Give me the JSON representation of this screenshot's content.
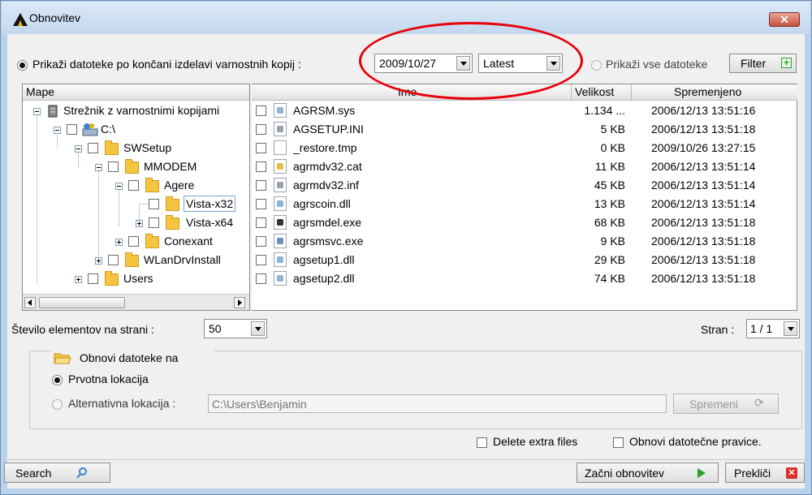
{
  "window": {
    "title": "Obnovitev",
    "close_label": "✕"
  },
  "options": {
    "show_after_backup_label": "Prikaži datoteke po končani izdelavi varnostnih kopij :",
    "date_value": "2009/10/27",
    "version_value": "Latest",
    "show_all_label": "Prikaži vse datoteke",
    "filter_label": "Filter"
  },
  "tree": {
    "header": "Mape",
    "items": [
      {
        "label": "Strežnik z varnostnimi kopijami"
      },
      {
        "label": "C:\\"
      },
      {
        "label": "SWSetup"
      },
      {
        "label": "MMODEM"
      },
      {
        "label": "Agere"
      },
      {
        "label": "Vista-x32"
      },
      {
        "label": "Vista-x64"
      },
      {
        "label": "Conexant"
      },
      {
        "label": "WLanDrvInstall"
      },
      {
        "label": "Users"
      }
    ]
  },
  "files": {
    "columns": {
      "name": "Ime",
      "size": "Velikost",
      "modified": "Spremenjeno"
    },
    "rows": [
      {
        "name": "AGRSM.sys",
        "size": "1.134 ...",
        "modified": "2006/12/13 13:51:16",
        "icon": "sys-file-icon"
      },
      {
        "name": "AGSETUP.INI",
        "size": "5 KB",
        "modified": "2006/12/13 13:51:18",
        "icon": "ini-file-icon"
      },
      {
        "name": "_restore.tmp",
        "size": "0 KB",
        "modified": "2009/10/26 13:27:15",
        "icon": "blank-file-icon"
      },
      {
        "name": "agrmdv32.cat",
        "size": "11 KB",
        "modified": "2006/12/13 13:51:14",
        "icon": "cat-file-icon"
      },
      {
        "name": "agrmdv32.inf",
        "size": "45 KB",
        "modified": "2006/12/13 13:51:14",
        "icon": "inf-file-icon"
      },
      {
        "name": "agrscoin.dll",
        "size": "13 KB",
        "modified": "2006/12/13 13:51:14",
        "icon": "dll-file-icon"
      },
      {
        "name": "agrsmdel.exe",
        "size": "68 KB",
        "modified": "2006/12/13 13:51:18",
        "icon": "exe-file-icon"
      },
      {
        "name": "agrsmsvc.exe",
        "size": "9 KB",
        "modified": "2006/12/13 13:51:18",
        "icon": "exe-window-icon"
      },
      {
        "name": "agsetup1.dll",
        "size": "29 KB",
        "modified": "2006/12/13 13:51:18",
        "icon": "dll-file-icon"
      },
      {
        "name": "agsetup2.dll",
        "size": "74 KB",
        "modified": "2006/12/13 13:51:18",
        "icon": "dll-file-icon"
      }
    ]
  },
  "paging": {
    "items_per_page_label": "Število elementov na strani :",
    "items_per_page_value": "50",
    "page_label": "Stran :",
    "page_value": "1 / 1"
  },
  "restore": {
    "group_label": "Obnovi datoteke na",
    "original_location_label": "Prvotna lokacija",
    "alternative_location_label": "Alternativna lokacija :",
    "alternative_path_placeholder": "C:\\Users\\Benjamin",
    "change_button_label": "Spremeni"
  },
  "extras": {
    "delete_extra_label": "Delete extra files",
    "restore_permissions_label": "Obnovi datotečne pravice."
  },
  "footer": {
    "search_label": "Search",
    "start_label": "Začni obnovitev",
    "cancel_label": "Prekliči"
  },
  "colors": {
    "annotation_red": "#e8000b",
    "title_bg": "#c3d7ee",
    "accent_green": "#2e9e2e"
  }
}
